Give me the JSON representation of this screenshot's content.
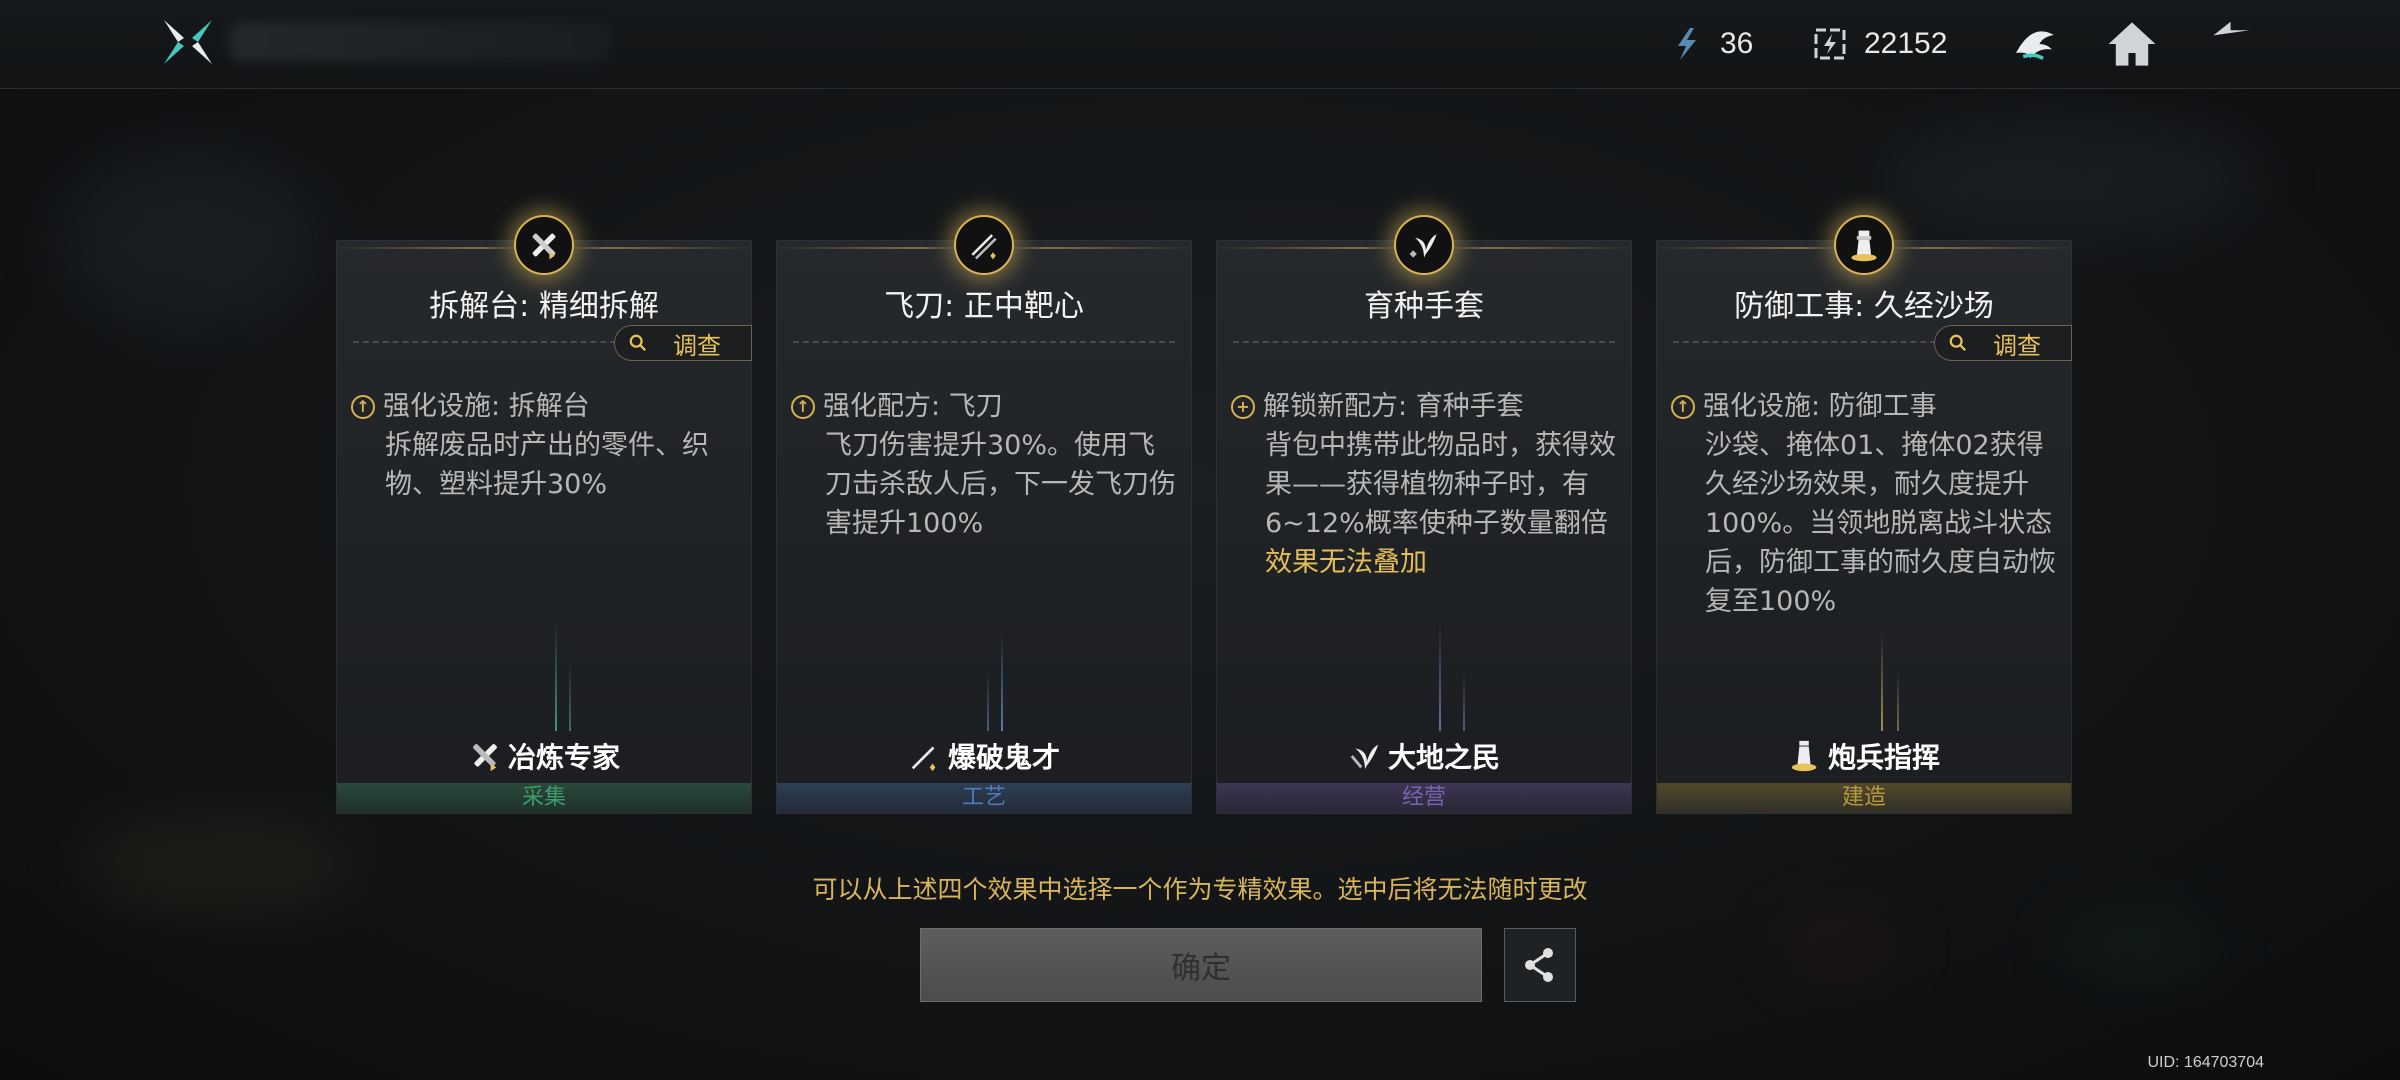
{
  "topbar": {
    "resources": [
      {
        "icon": "energy-shard-icon",
        "value": "36"
      },
      {
        "icon": "gear-currency-icon",
        "value": "22152"
      }
    ],
    "buttons": [
      {
        "icon": "emblem-icon"
      },
      {
        "icon": "home-icon"
      },
      {
        "icon": "back-arrow-icon"
      }
    ]
  },
  "cards": [
    {
      "title": "拆解台: 精细拆解",
      "has_investigate": true,
      "investigate_label": "调查",
      "effect_type_icon": "upgrade-icon",
      "effect_head": "强化设施: 拆解台",
      "effect_desc": "拆解废品时产出的零件、织物、塑料提升30%",
      "effect_warning": "",
      "specialist_name": "冶炼专家",
      "category": "采集",
      "category_color": "#3f9a6c",
      "beam_color": "#58c79a",
      "icon": "dismantle-wrench-icon"
    },
    {
      "title": "飞刀: 正中靶心",
      "has_investigate": false,
      "investigate_label": "",
      "effect_type_icon": "upgrade-icon",
      "effect_head": "强化配方: 飞刀",
      "effect_desc": "飞刀伤害提升30%。使用飞刀击杀敌人后，下一发飞刀伤害提升100%",
      "effect_warning": "",
      "specialist_name": "爆破鬼才",
      "category": "工艺",
      "category_color": "#4f7bb8",
      "beam_color": "#6fa0e0",
      "icon": "throwing-knife-icon"
    },
    {
      "title": "育种手套",
      "has_investigate": false,
      "investigate_label": "",
      "effect_type_icon": "plus-icon",
      "effect_head": "解锁新配方: 育种手套",
      "effect_desc": "背包中携带此物品时，获得效果——获得植物种子时，有6~12%概率使种子数量翻倍",
      "effect_warning": "效果无法叠加",
      "specialist_name": "大地之民",
      "category": "经营",
      "category_color": "#7b62b0",
      "beam_color": "#9a86d8",
      "icon": "seedling-glove-icon"
    },
    {
      "title": "防御工事: 久经沙场",
      "has_investigate": true,
      "investigate_label": "调查",
      "effect_type_icon": "upgrade-icon",
      "effect_head": "强化设施: 防御工事",
      "effect_desc": "沙袋、掩体01、掩体02获得久经沙场效果，耐久度提升100%。当领地脱离战斗状态后，防御工事的耐久度自动恢复至100%",
      "effect_warning": "",
      "specialist_name": "炮兵指挥",
      "category": "建造",
      "category_color": "#b59a3e",
      "beam_color": "#d8bf5c",
      "icon": "watchtower-icon"
    }
  ],
  "hint": "可以从上述四个效果中选择一个作为专精效果。选中后将无法随时更改",
  "confirm_label": "确定",
  "uid": "UID: 164703704"
}
